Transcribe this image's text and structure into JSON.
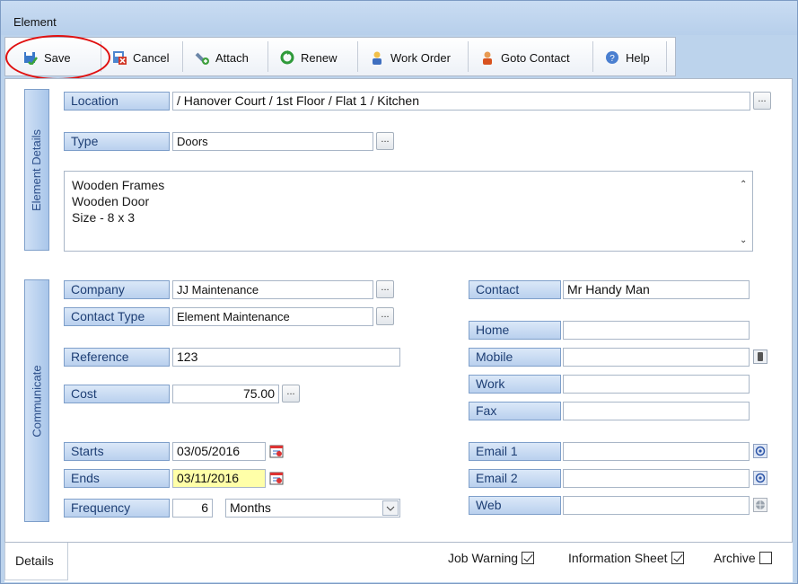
{
  "window": {
    "title": "Element"
  },
  "toolbar": {
    "save": "Save",
    "cancel": "Cancel",
    "attach": "Attach",
    "renew": "Renew",
    "work_order": "Work Order",
    "goto_contact": "Goto Contact",
    "help": "Help"
  },
  "element_details": {
    "tab_label": "Element Details",
    "location_label": "Location",
    "location_value": "/ Hanover Court / 1st Floor / Flat 1 / Kitchen",
    "type_label": "Type",
    "type_value": "Doors",
    "notes": [
      "Wooden  Frames",
      "Wooden Door",
      "Size - 8 x 3"
    ]
  },
  "communicate": {
    "tab_label": "Communicate",
    "company_label": "Company",
    "company_value": "JJ Maintenance",
    "contact_type_label": "Contact Type",
    "contact_type_value": "Element Maintenance",
    "reference_label": "Reference",
    "reference_value": "123",
    "cost_label": "Cost",
    "cost_value": "75.00",
    "starts_label": "Starts",
    "starts_value": "03/05/2016",
    "ends_label": "Ends",
    "ends_value": "03/11/2016",
    "frequency_label": "Frequency",
    "frequency_value": "6",
    "frequency_unit": "Months",
    "contact_label": "Contact",
    "contact_value": "Mr Handy Man",
    "home_label": "Home",
    "home_value": "",
    "mobile_label": "Mobile",
    "mobile_value": "",
    "work_label": "Work",
    "work_value": "",
    "fax_label": "Fax",
    "fax_value": "",
    "email1_label": "Email 1",
    "email1_value": "",
    "email2_label": "Email 2",
    "email2_value": "",
    "web_label": "Web",
    "web_value": ""
  },
  "footer": {
    "details_tab": "Details",
    "job_warning": "Job Warning",
    "job_warning_checked": true,
    "information_sheet": "Information Sheet",
    "information_sheet_checked": true,
    "archive": "Archive",
    "archive_checked": false
  },
  "colors": {
    "label_text": "#1d3e74",
    "highlight_field": "#ffffa8",
    "annotation_ring": "#e01010"
  }
}
